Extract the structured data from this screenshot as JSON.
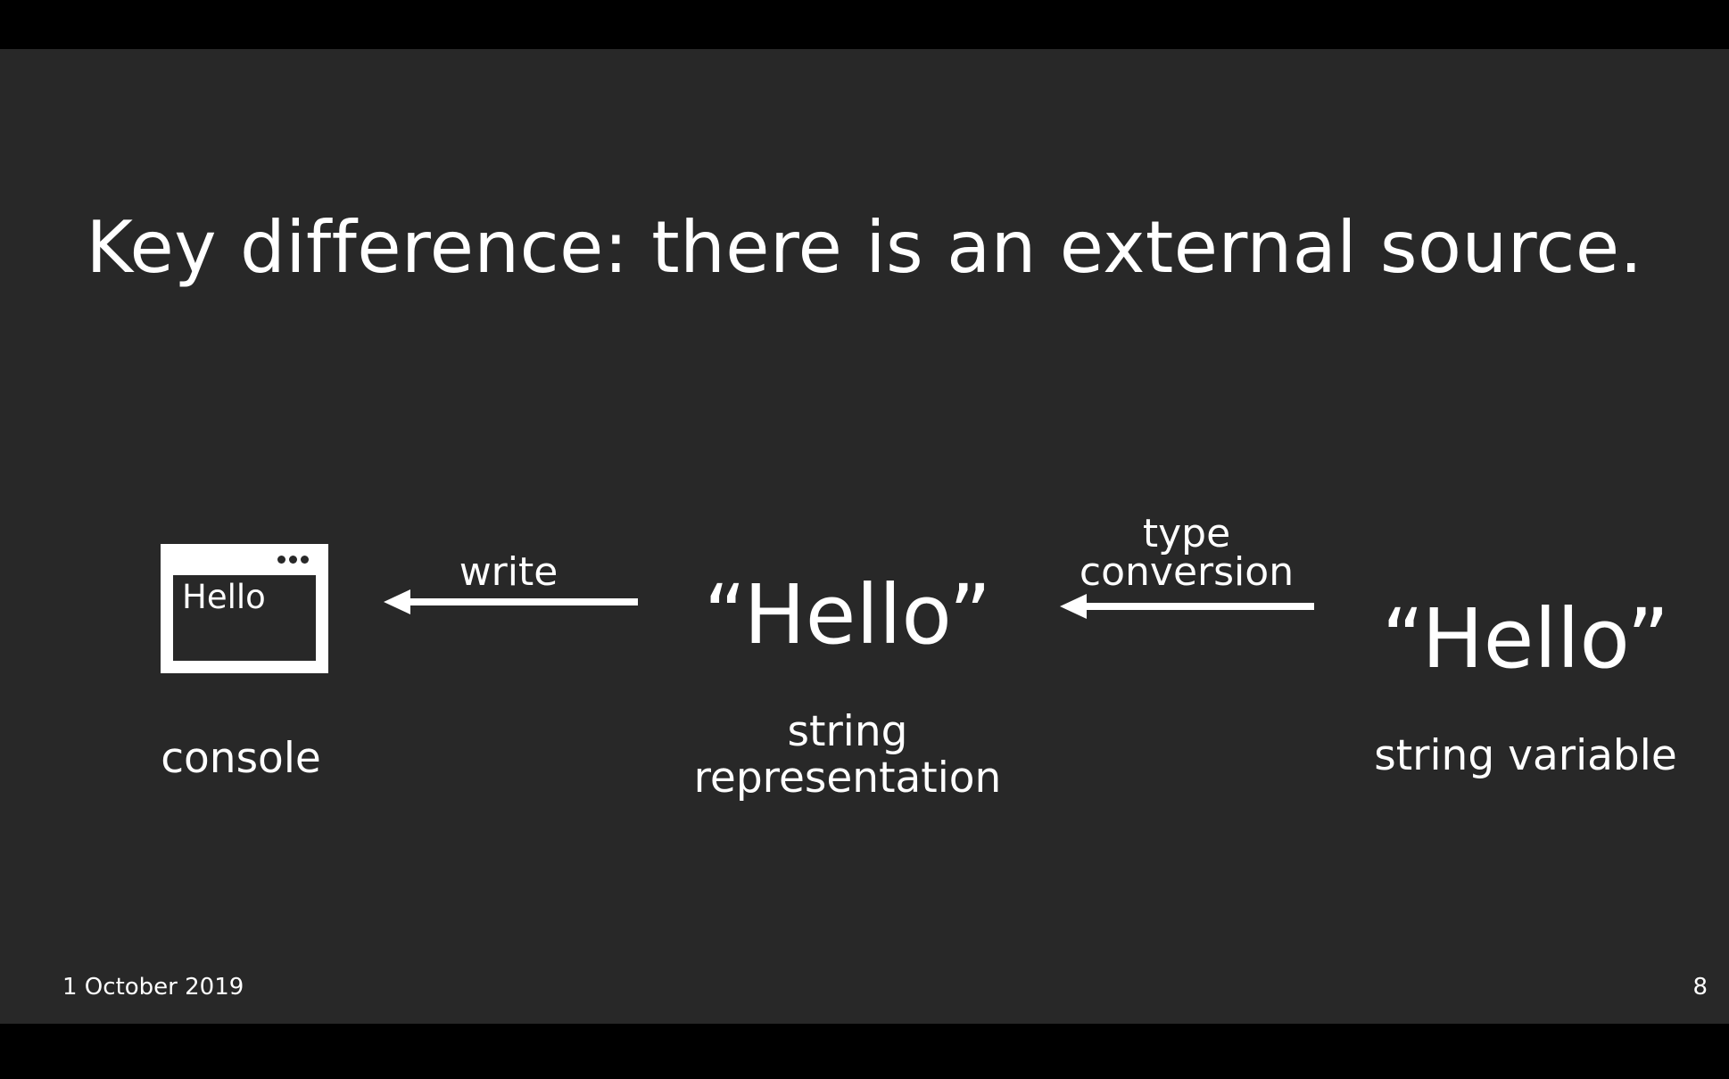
{
  "slide": {
    "title": "Key difference: there is an external source.",
    "console": {
      "window_text": "Hello",
      "label": "console"
    },
    "arrow_write": {
      "label": "write"
    },
    "string_representation": {
      "value": "“Hello”",
      "label_line1": "string",
      "label_line2": "representation"
    },
    "arrow_conversion": {
      "label_line1": "type",
      "label_line2": "conversion"
    },
    "string_variable": {
      "value": "“Hello”",
      "label": "string variable"
    },
    "footer": {
      "date": "1 October 2019",
      "page_number": "8"
    }
  },
  "colors": {
    "background": "#282828",
    "letterbox": "#000000",
    "foreground": "#ffffff"
  },
  "icons": {
    "console": "console-window-icon",
    "arrows": "left-arrow-icon"
  }
}
